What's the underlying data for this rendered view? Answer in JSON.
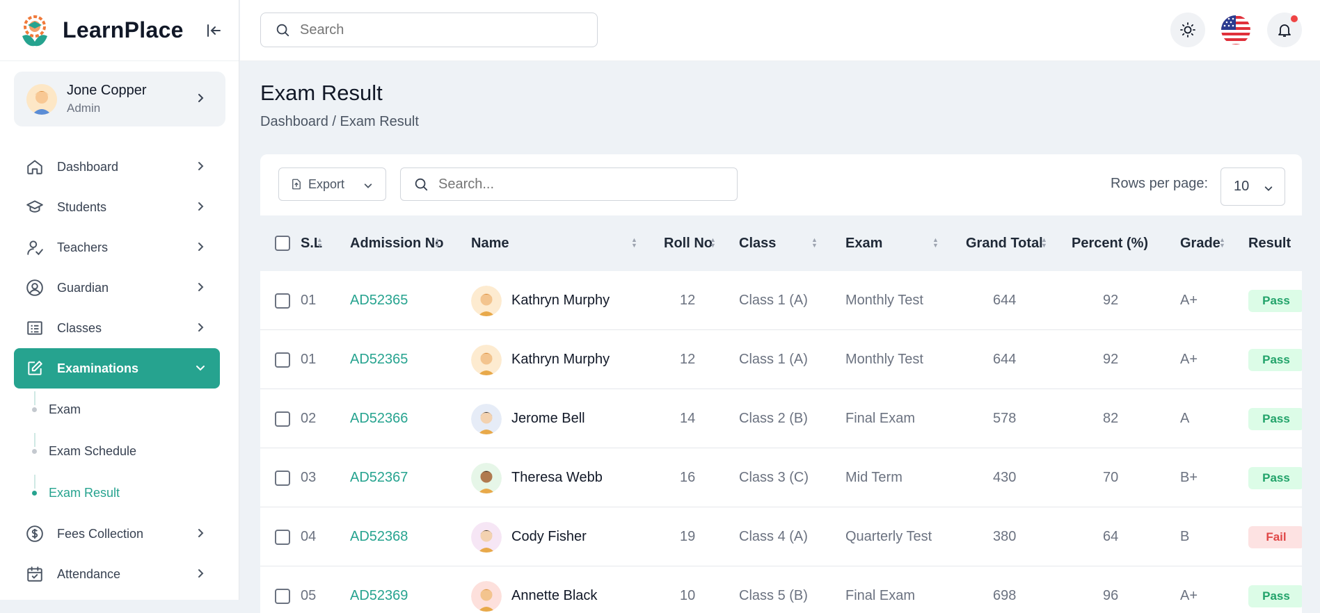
{
  "app": {
    "name": "LearnPlace"
  },
  "user": {
    "name": "Jone Copper",
    "role": "Admin"
  },
  "sidebar": {
    "items": [
      {
        "label": "Dashboard",
        "icon": "home-icon"
      },
      {
        "label": "Students",
        "icon": "graduation-cap-icon"
      },
      {
        "label": "Teachers",
        "icon": "user-check-icon"
      },
      {
        "label": "Guardian",
        "icon": "user-circle-icon"
      },
      {
        "label": "Classes",
        "icon": "list-icon"
      },
      {
        "label": "Examinations",
        "icon": "edit-icon"
      }
    ],
    "sub_items": [
      {
        "label": "Exam"
      },
      {
        "label": "Exam Schedule"
      },
      {
        "label": "Exam Result"
      }
    ],
    "items_after": [
      {
        "label": "Fees Collection",
        "icon": "dollar-circle-icon"
      },
      {
        "label": "Attendance",
        "icon": "calendar-check-icon"
      }
    ]
  },
  "topbar": {
    "search_placeholder": "Search"
  },
  "page": {
    "title": "Exam Result",
    "breadcrumb": "Dashboard / Exam Result"
  },
  "toolbar": {
    "export_label": "Export",
    "search_placeholder": "Search...",
    "rows_per_page_label": "Rows per page:",
    "rows_per_page_value": "10"
  },
  "table": {
    "columns": [
      "S.L",
      "Admission No",
      "Name",
      "Roll No",
      "Class",
      "Exam",
      "Grand Total",
      "Percent (%)",
      "Grade",
      "Result"
    ],
    "rows": [
      {
        "sl": "01",
        "admission": "AD52365",
        "name": "Kathryn Murphy",
        "roll": "12",
        "class": "Class 1 (A)",
        "exam": "Monthly Test",
        "total": "644",
        "percent": "92",
        "grade": "A+",
        "result": "Pass"
      },
      {
        "sl": "01",
        "admission": "AD52365",
        "name": "Kathryn Murphy",
        "roll": "12",
        "class": "Class 1 (A)",
        "exam": "Monthly Test",
        "total": "644",
        "percent": "92",
        "grade": "A+",
        "result": "Pass"
      },
      {
        "sl": "02",
        "admission": "AD52366",
        "name": "Jerome Bell",
        "roll": "14",
        "class": "Class 2 (B)",
        "exam": "Final Exam",
        "total": "578",
        "percent": "82",
        "grade": "A",
        "result": "Pass"
      },
      {
        "sl": "03",
        "admission": "AD52367",
        "name": "Theresa Webb",
        "roll": "16",
        "class": "Class 3 (C)",
        "exam": "Mid Term",
        "total": "430",
        "percent": "70",
        "grade": "B+",
        "result": "Pass"
      },
      {
        "sl": "04",
        "admission": "AD52368",
        "name": "Cody Fisher",
        "roll": "19",
        "class": "Class 4 (A)",
        "exam": "Quarterly Test",
        "total": "380",
        "percent": "64",
        "grade": "B",
        "result": "Fail"
      },
      {
        "sl": "05",
        "admission": "AD52369",
        "name": "Annette Black",
        "roll": "10",
        "class": "Class 5 (B)",
        "exam": "Final Exam",
        "total": "698",
        "percent": "96",
        "grade": "A+",
        "result": "Pass"
      }
    ]
  },
  "colors": {
    "accent": "#26a38f",
    "pass": "#22a36a",
    "fail": "#e04848",
    "notification": "#ef4444"
  }
}
